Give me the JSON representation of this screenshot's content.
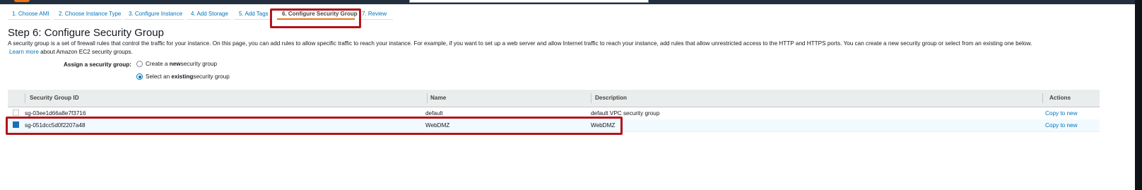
{
  "wizard": {
    "steps": [
      {
        "label": "1. Choose AMI",
        "active": false
      },
      {
        "label": "2. Choose Instance Type",
        "active": false
      },
      {
        "label": "3. Configure Instance",
        "active": false
      },
      {
        "label": "4. Add Storage",
        "active": false
      },
      {
        "label": "5. Add Tags",
        "active": false
      },
      {
        "label": "6. Configure Security Group",
        "active": true
      },
      {
        "label": "7. Review",
        "active": false
      }
    ]
  },
  "page": {
    "title": "Step 6: Configure Security Group",
    "description": "A security group is a set of firewall rules that control the traffic for your instance. On this page, you can add rules to allow specific traffic to reach your instance. For example, if you want to set up a web server and allow Internet traffic to reach your instance, add rules that allow unrestricted access to the HTTP and HTTPS ports. You can create a new security group or select from an existing one below.",
    "learn_more": "Learn more",
    "learn_more_suffix": " about Amazon EC2 security groups."
  },
  "assign": {
    "label": "Assign a security group:",
    "options": [
      {
        "prefix": "Create a ",
        "bold": "new",
        "suffix": " security group",
        "checked": false
      },
      {
        "prefix": "Select an ",
        "bold": "existing",
        "suffix": " security group",
        "checked": true
      }
    ]
  },
  "table": {
    "columns": [
      "Security Group ID",
      "Name",
      "Description",
      "Actions"
    ],
    "rows": [
      {
        "id": "sg-03ee1d66a8e7f3716",
        "name": "default",
        "description": "default VPC security group",
        "action": "Copy to new",
        "selected": false
      },
      {
        "id": "sg-051dcc5d0f2207a48",
        "name": "WebDMZ",
        "description": "WebDMZ",
        "action": "Copy to new",
        "selected": true
      }
    ]
  },
  "colors": {
    "highlight": "#b3131b",
    "link": "#0073bb",
    "active_tab": "#ec7211"
  }
}
